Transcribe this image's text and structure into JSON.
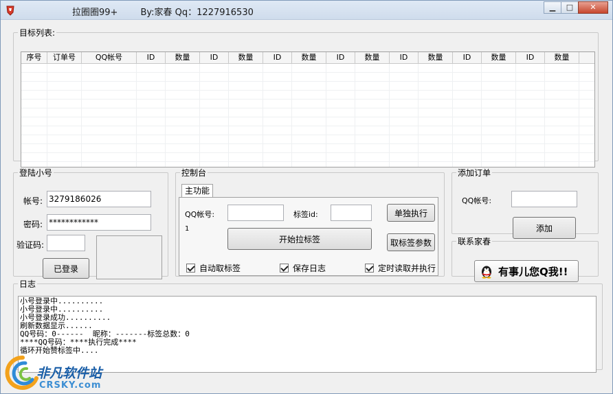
{
  "window": {
    "title": "拉圈圈99+        By:家春 Qq：1227916530",
    "minimize_glyph": "▁",
    "maximize_glyph": "□",
    "close_glyph": "✕"
  },
  "target_list": {
    "legend": "目标列表:",
    "columns": [
      "序号",
      "订单号",
      "QQ帐号",
      "ID",
      "数量",
      "ID",
      "数量",
      "ID",
      "数量",
      "ID",
      "数量",
      "ID",
      "数量",
      "ID",
      "数量",
      "ID",
      "数量"
    ]
  },
  "login": {
    "legend": "登陆小号",
    "account_label": "帐号:",
    "account_value": "3279186026",
    "password_label": "密码:",
    "password_value": "************",
    "captcha_label": "验证码:",
    "captcha_value": "",
    "login_button": "已登录"
  },
  "console": {
    "legend": "控制台",
    "tab_main": "主功能",
    "qq_label": "QQ帐号:",
    "qq_value": "",
    "tag_id_label": "标签id:",
    "tag_id_value": "",
    "single_exec_button": "单独执行",
    "counter_text": "1",
    "start_button": "开始拉标签",
    "fetch_params_button": "取标签参数",
    "auto_fetch_label": "自动取标签",
    "save_log_label": "保存日志",
    "timed_read_label": "定时读取并执行"
  },
  "add_order": {
    "legend": "添加订单",
    "qq_label": "QQ帐号:",
    "qq_value": "",
    "add_button": "添加"
  },
  "contact": {
    "legend": "联系家春",
    "qq_button_text": "有事儿您Q我!!"
  },
  "log": {
    "legend": "日志",
    "lines": [
      "小号登录中..........",
      "小号登录中..........",
      "小号登录成功..........",
      "刷新数据显示......",
      "QQ号码：0------  昵称：-------标签总数：0",
      "****QQ号码：****执行完成****",
      "循环开始赞标签中...."
    ]
  },
  "watermark": {
    "cn": "非凡软件站",
    "en": "CRSKY.com"
  }
}
